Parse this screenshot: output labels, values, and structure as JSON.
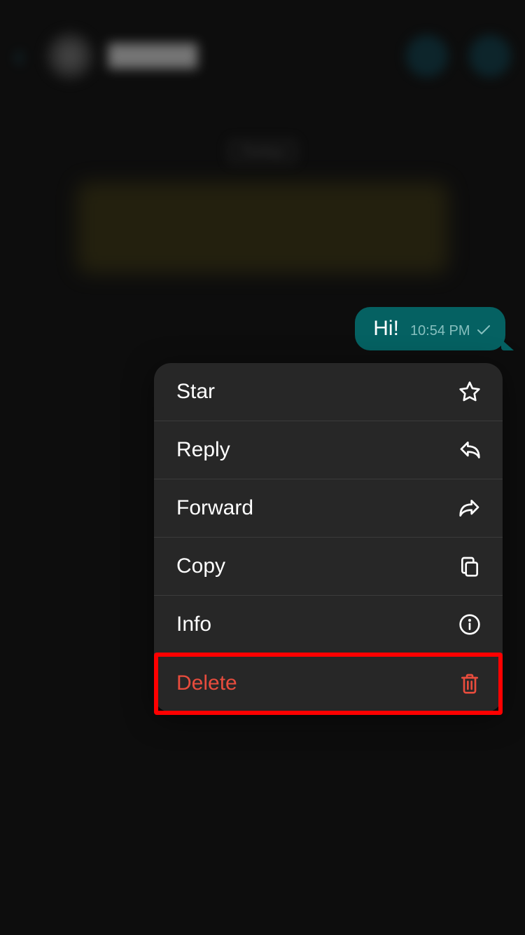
{
  "background": {
    "date_label": "Today"
  },
  "message": {
    "text": "Hi!",
    "time": "10:54 PM"
  },
  "menu": {
    "star": "Star",
    "reply": "Reply",
    "forward": "Forward",
    "copy": "Copy",
    "info": "Info",
    "delete": "Delete"
  }
}
